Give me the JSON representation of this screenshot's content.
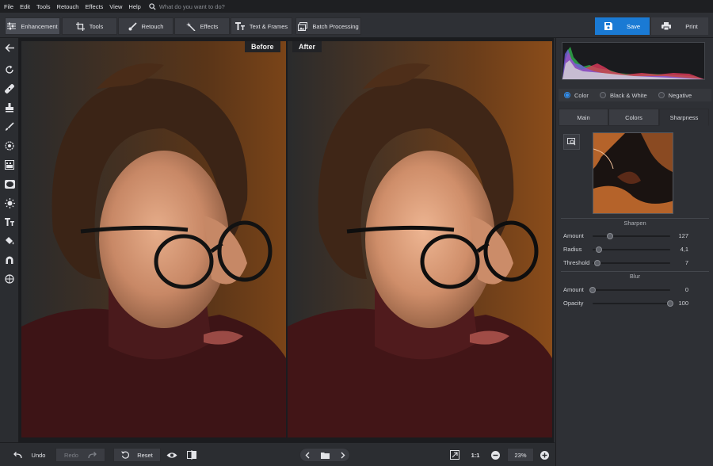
{
  "menu": {
    "items": [
      "File",
      "Edit",
      "Tools",
      "Retouch",
      "Effects",
      "View",
      "Help"
    ],
    "search_placeholder": "What do you want to do?"
  },
  "toolbar": {
    "tabs": [
      {
        "label": "Enhancement",
        "icon": "sliders-icon",
        "active": true
      },
      {
        "label": "Tools",
        "icon": "crop-icon"
      },
      {
        "label": "Retouch",
        "icon": "brush-icon"
      },
      {
        "label": "Effects",
        "icon": "magic-wand-icon"
      },
      {
        "label": "Text & Frames",
        "icon": "text-icon"
      },
      {
        "label": "Batch Processing",
        "icon": "images-icon"
      }
    ],
    "save_label": "Save",
    "print_label": "Print"
  },
  "canvas": {
    "before_label": "Before",
    "after_label": "After"
  },
  "panel": {
    "modes": [
      {
        "label": "Color",
        "selected": true
      },
      {
        "label": "Black & White"
      },
      {
        "label": "Negative"
      }
    ],
    "subtabs": [
      {
        "label": "Main"
      },
      {
        "label": "Colors"
      },
      {
        "label": "Sharpness",
        "active": true
      }
    ],
    "sharpen": {
      "title": "Sharpen",
      "sliders": [
        {
          "label": "Amount",
          "value": "127",
          "level": 0.22
        },
        {
          "label": "Radius",
          "value": "4,1",
          "level": 0.08
        },
        {
          "label": "Threshold",
          "value": "7",
          "level": 0.06
        }
      ]
    },
    "blur": {
      "title": "Blur",
      "sliders": [
        {
          "label": "Amount",
          "value": "0",
          "level": 0.0
        },
        {
          "label": "Opacity",
          "value": "100",
          "level": 1.0
        }
      ]
    }
  },
  "bottom": {
    "undo_label": "Undo",
    "redo_label": "Redo",
    "reset_label": "Reset",
    "ratio_label": "1:1",
    "zoom_value": "23%"
  },
  "colors": {
    "accent": "#1a7ad4",
    "panel_bg": "#2e3035",
    "toolbar_bg": "#2e3035"
  }
}
